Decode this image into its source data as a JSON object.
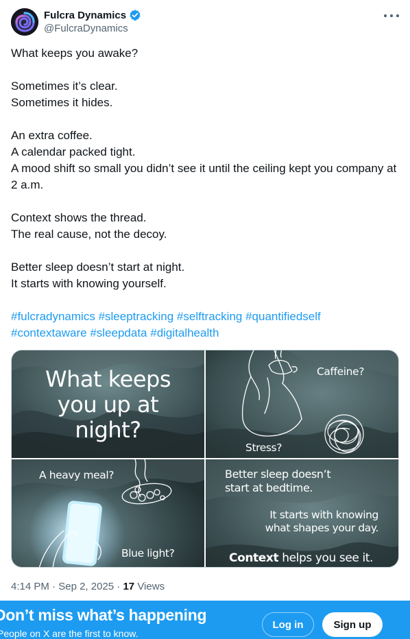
{
  "account": {
    "name": "Fulcra Dynamics",
    "handle": "@FulcraDynamics",
    "verified": true,
    "verified_color": "#1d9bf0",
    "avatar_icon": "spiral-logo-icon"
  },
  "tweet": {
    "lines": [
      "What keeps you awake?",
      "Sometimes it’s clear.",
      "Sometimes it hides.",
      "An extra coffee.",
      "A calendar packed tight.",
      "A mood shift so small you didn’t see it until the ceiling kept you company at 2 a.m.",
      "Context shows the thread.",
      "The real cause, not the decoy.",
      "Better sleep doesn’t start at night.",
      "It starts with knowing yourself."
    ],
    "hashtags_line1": [
      "#fulcradynamics",
      "#sleeptracking",
      "#selftracking",
      "#quantifiedself"
    ],
    "hashtags_line2": [
      "#contextaware",
      "#sleepdata",
      "#digitalhealth"
    ],
    "link_color": "#1d9bf0"
  },
  "media": {
    "panel1": {
      "line1": "What keeps",
      "line2": "you up at",
      "line3": "night?"
    },
    "panel2": {
      "caffeine": "Caffeine?",
      "stress": "Stress?"
    },
    "panel3": {
      "meal": "A heavy meal?",
      "light": "Blue light?"
    },
    "panel4": {
      "line1": "Better sleep doesn’t",
      "line2": "start at bedtime.",
      "line3": "It starts with knowing",
      "line4": "what shapes your day.",
      "context_word": "Context",
      "context_rest": " helps you see it."
    }
  },
  "meta": {
    "time": "4:14 PM",
    "date": "Sep 2, 2025",
    "views_count": "17",
    "views_label": "Views"
  },
  "banner": {
    "title": "Don’t miss what’s happening",
    "subtitle": "People on X are the first to know.",
    "login_label": "Log in",
    "signup_label": "Sign up",
    "background": "#1d9bf0"
  }
}
